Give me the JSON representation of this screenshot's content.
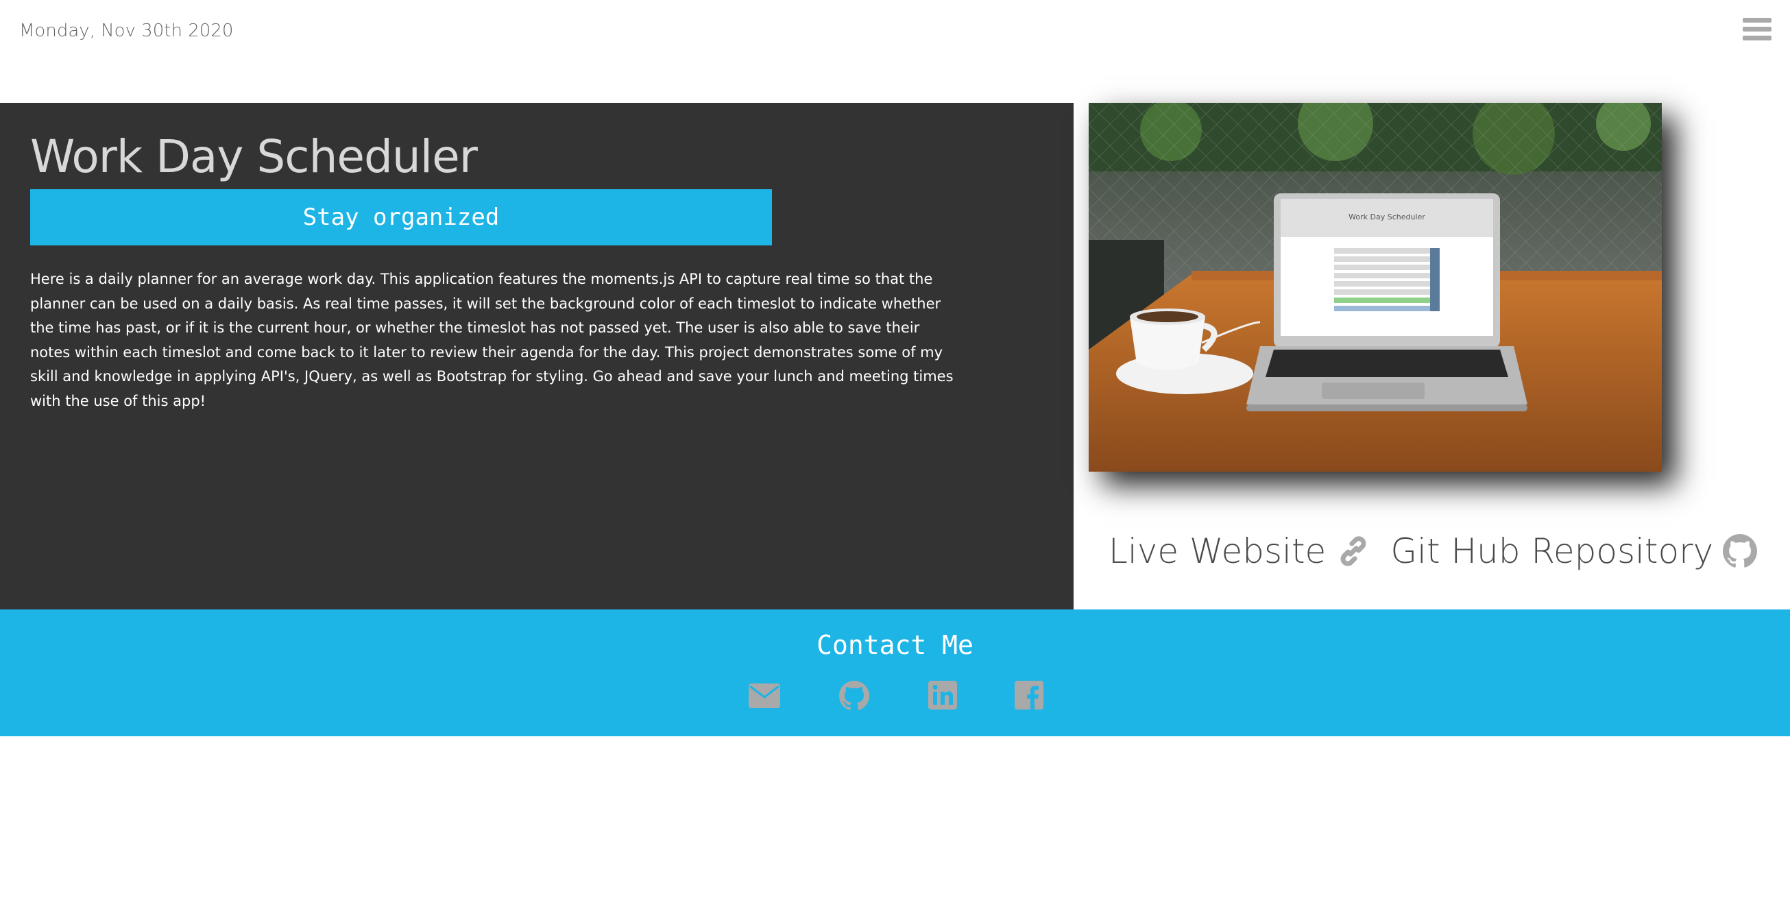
{
  "header": {
    "date": "Monday, Nov 30th 2020",
    "menu_icon": "hamburger-menu-icon"
  },
  "project": {
    "title": "Work Day Scheduler",
    "subtitle": "Stay organized",
    "description": "Here is a daily planner for an average work day. This application features the moments.js API to capture real time so that the planner can be used on a daily basis. As real time passes, it will set the background color of each timeslot to indicate whether the time has past, or if it is the current hour, or whether the timeslot has not passed yet. The user is also able to save their notes within each timeslot and come back to it later to review their agenda for the day. This project demonstrates some of my skill and knowledge in applying API's, JQuery, as well as Bootstrap for styling. Go ahead and save your lunch and meeting times with the use of this app!",
    "screenshot_title": "Work Day Scheduler",
    "links": [
      {
        "label": "Live Website",
        "icon": "link-icon"
      },
      {
        "label": "Git Hub Repository",
        "icon": "github-icon"
      }
    ]
  },
  "footer": {
    "title": "Contact Me",
    "icons": [
      "envelope-icon",
      "github-icon",
      "linkedin-icon",
      "facebook-icon"
    ]
  },
  "colors": {
    "accent": "#1db4e6",
    "panel": "#333333",
    "icon_gray": "#a9a9a9"
  }
}
